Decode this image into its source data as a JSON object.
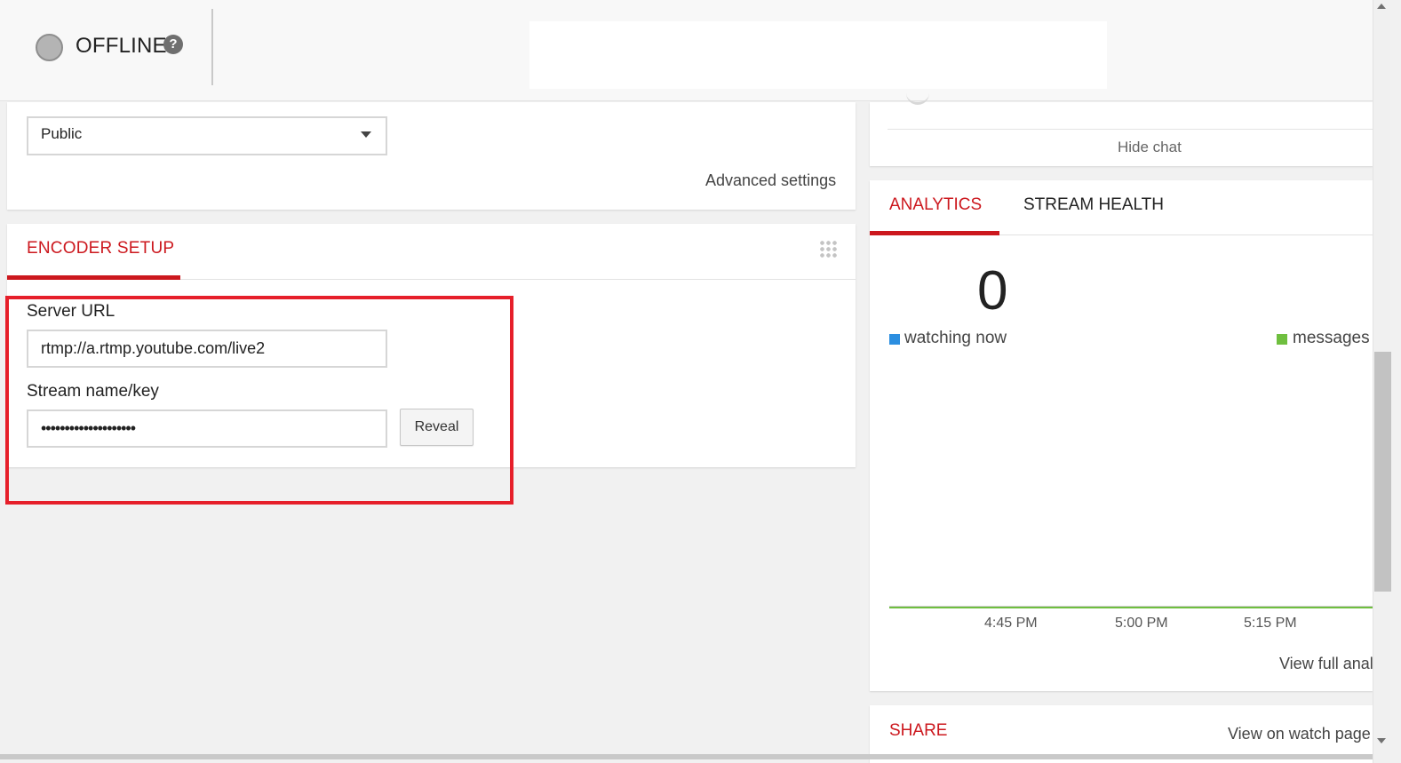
{
  "header": {
    "status": "OFFLINE",
    "help_icon": "?"
  },
  "privacy": {
    "selected": "Public",
    "advanced_link": "Advanced settings"
  },
  "encoder": {
    "tab_label": "ENCODER SETUP",
    "server_url_label": "Server URL",
    "server_url_value": "rtmp://a.rtmp.youtube.com/live2",
    "stream_key_label": "Stream name/key",
    "stream_key_value": "••••••••••••••••••••",
    "reveal_label": "Reveal",
    "highlight_color": "#e61f2a"
  },
  "chat": {
    "hide_label": "Hide chat"
  },
  "analytics": {
    "tab_analytics": "ANALYTICS",
    "tab_stream_health": "STREAM HEALTH",
    "watching_count": "0",
    "legend_watching": "watching now",
    "legend_messages": "messages",
    "watching_color": "#2b8ee0",
    "messages_color": "#6fbf3f",
    "ticks": [
      "4:45 PM",
      "5:00 PM",
      "5:15 PM"
    ],
    "view_full": "View full analytics"
  },
  "share": {
    "title": "SHARE",
    "watch_link": "View on watch page"
  },
  "colors": {
    "accent": "#cc181e",
    "background": "#f1f1f1"
  }
}
